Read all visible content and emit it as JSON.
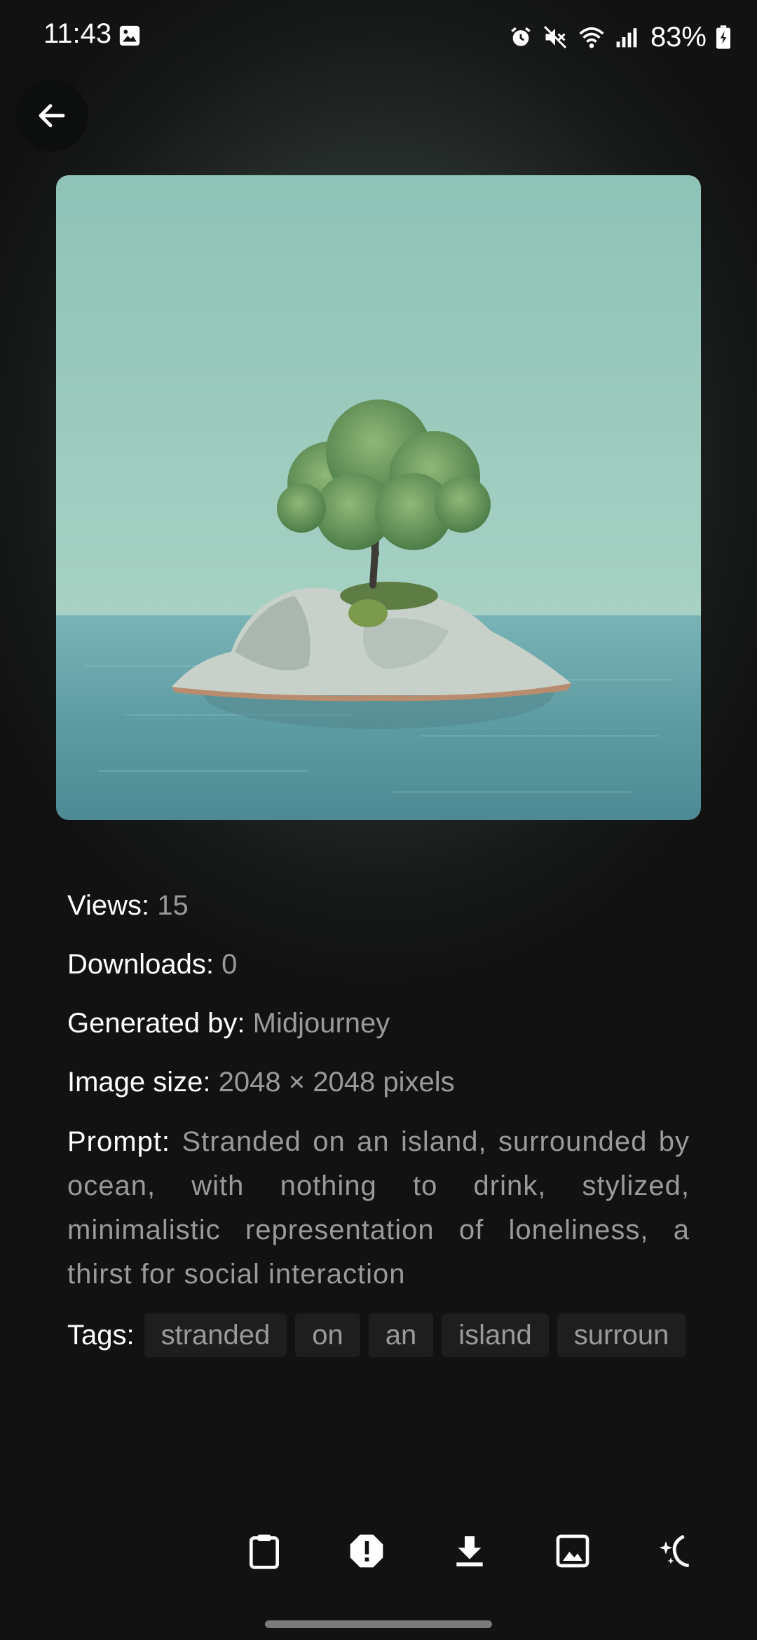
{
  "status_bar": {
    "time": "11:43",
    "battery": "83%",
    "icons": [
      "gallery-icon",
      "alarm-icon",
      "mute-icon",
      "wifi-icon",
      "signal-icon",
      "battery-icon"
    ]
  },
  "navigation": {
    "back_icon": "arrow-left-icon"
  },
  "image": {
    "description_icon": "tree-on-rock-island-photo"
  },
  "details": {
    "views_label": "Views:",
    "views_value": "15",
    "downloads_label": "Downloads:",
    "downloads_value": "0",
    "generated_label": "Generated by:",
    "generated_value": "Midjourney",
    "size_label": "Image size:",
    "size_value": "2048 × 2048 pixels",
    "prompt_label": "Prompt:",
    "prompt_value": "Stranded on an island, surrounded by ocean, with nothing to drink, stylized, minimalistic representation of loneliness, a thirst for social interaction"
  },
  "tags": {
    "label": "Tags:",
    "items": [
      "stranded",
      "on",
      "an",
      "island",
      "surroun"
    ]
  },
  "actions": [
    "clipboard-icon",
    "report-icon",
    "download-icon",
    "image-icon",
    "magic-icon"
  ],
  "colors": {
    "background": "#121212",
    "muted_text": "#9a9a9a",
    "tag_bg": "#1e1e1e"
  }
}
